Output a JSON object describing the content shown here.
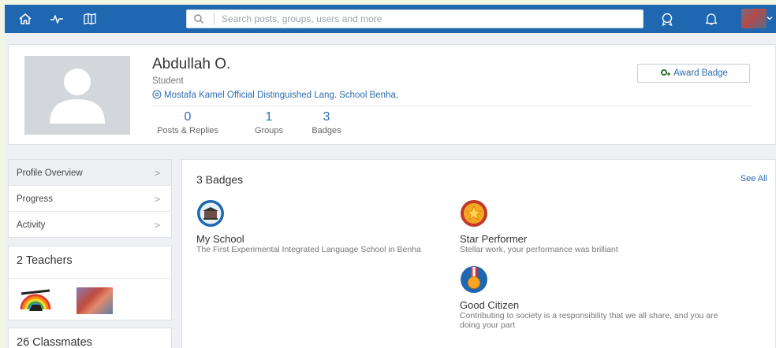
{
  "header": {
    "search_placeholder": "Search posts, groups, users and more",
    "icons": [
      "home-icon",
      "activity-pulse-icon",
      "book-map-icon",
      "badge-ring-icon",
      "bell-icon"
    ]
  },
  "profile": {
    "name": "Abdullah O.",
    "role": "Student",
    "school": "Mostafa Kamel Official Distinguished Lang. School Benha,",
    "award_button": "Award Badge",
    "stats": [
      {
        "value": "0",
        "label": "Posts & Replies"
      },
      {
        "value": "1",
        "label": "Groups"
      },
      {
        "value": "3",
        "label": "Badges"
      }
    ]
  },
  "sidebar": {
    "menu": [
      {
        "label": "Profile Overview",
        "chevron": ">"
      },
      {
        "label": "Progress",
        "chevron": ">"
      },
      {
        "label": "Activity",
        "chevron": ">"
      }
    ],
    "teachers_title": "2 Teachers",
    "classmates_title": "26 Classmates"
  },
  "badges": {
    "title": "3 Badges",
    "see_all": "See All",
    "items": [
      {
        "name": "My School",
        "desc": "The First Experimental Integrated Language School in Benha",
        "icon": "school-badge-icon"
      },
      {
        "name": "Star Performer",
        "desc": "Stellar work, your performance was brilliant",
        "icon": "star-badge-icon"
      },
      {
        "name": "Good Citizen",
        "desc": "Contributing to society is a responsibility that we all share, and you are doing your part",
        "icon": "medal-badge-icon"
      }
    ]
  },
  "colors": {
    "brand": "#1f67b0",
    "link": "#2b6cb0"
  }
}
